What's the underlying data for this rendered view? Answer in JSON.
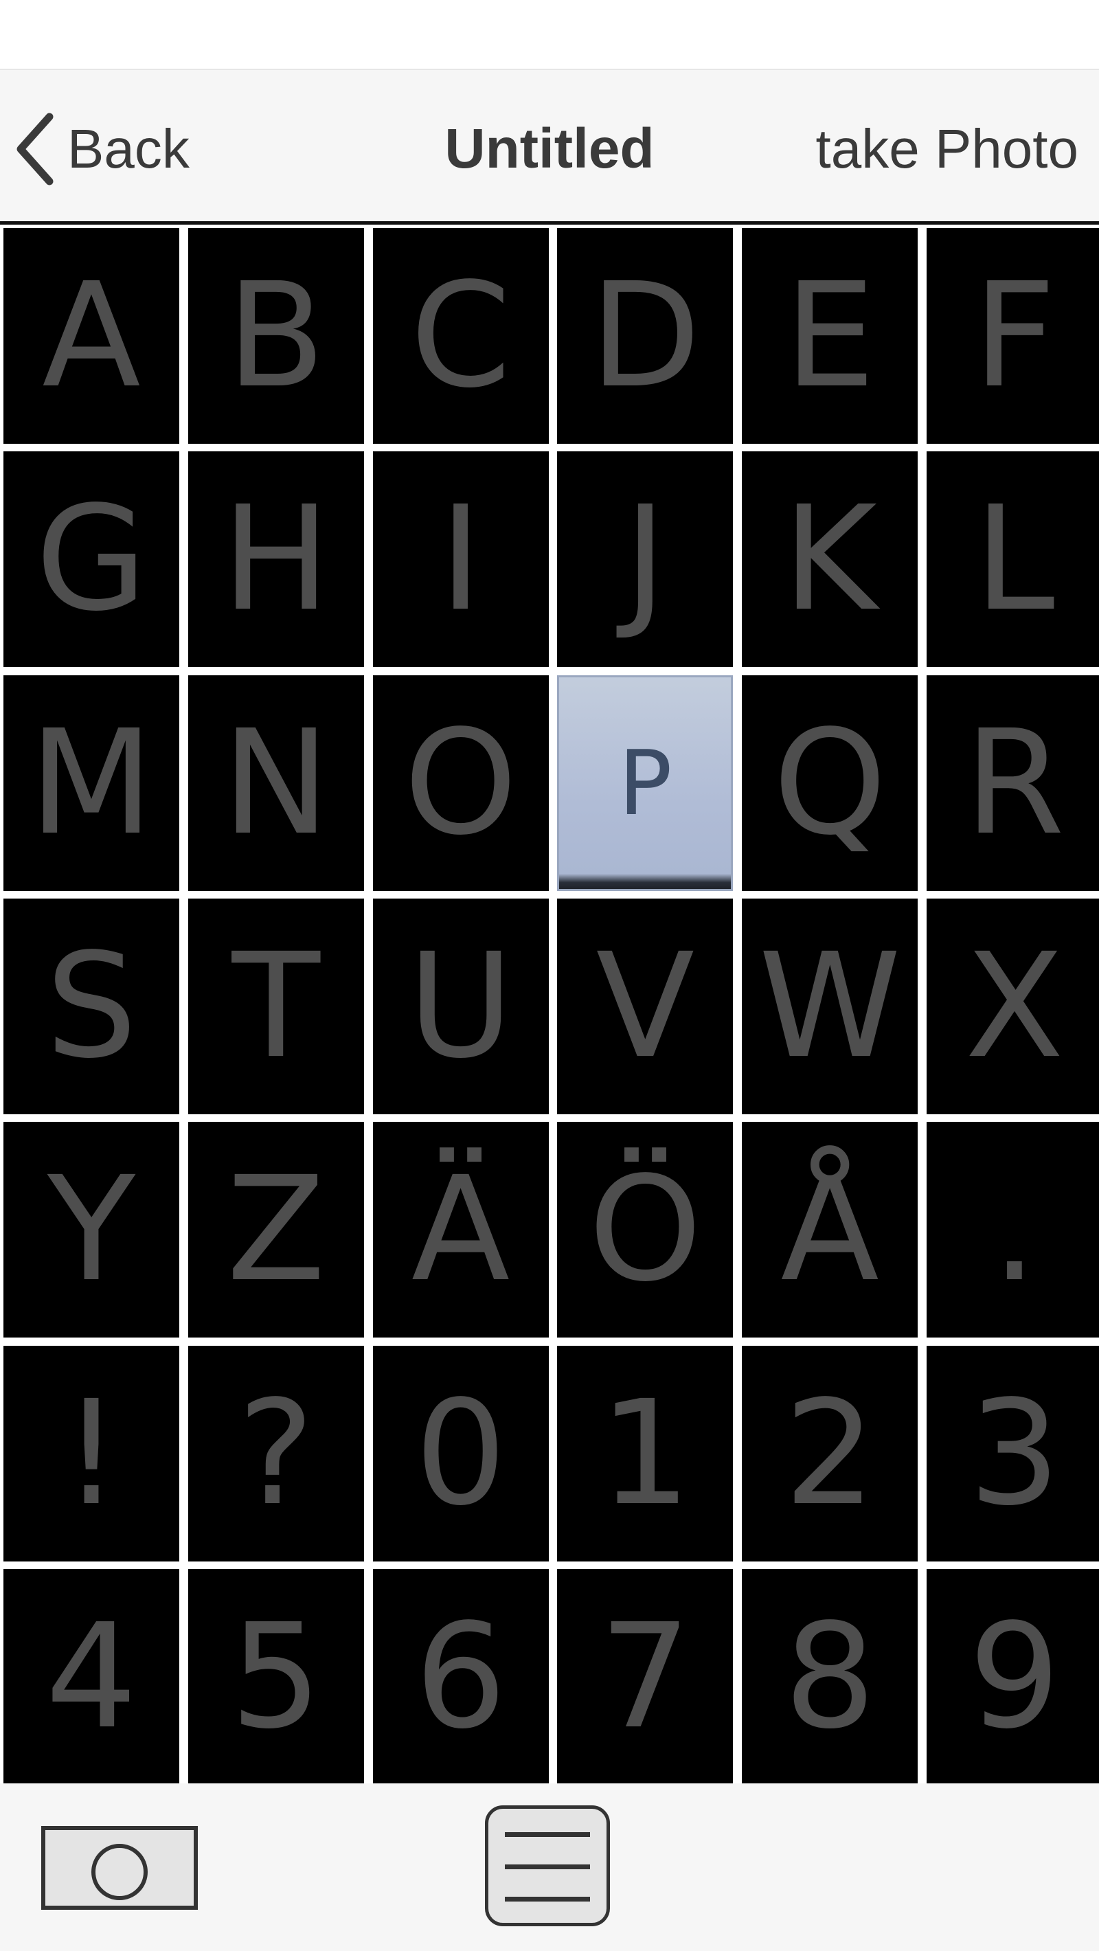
{
  "nav": {
    "back_label": "Back",
    "title": "Untitled",
    "take_photo_label": "take Photo"
  },
  "grid": {
    "selected": "P",
    "cells": [
      "A",
      "B",
      "C",
      "D",
      "E",
      "F",
      "G",
      "H",
      "I",
      "J",
      "K",
      "L",
      "M",
      "N",
      "O",
      "P",
      "Q",
      "R",
      "S",
      "T",
      "U",
      "V",
      "W",
      "X",
      "Y",
      "Z",
      "Ä",
      "Ö",
      "Å",
      ".",
      "!",
      "?",
      "0",
      "1",
      "2",
      "3",
      "4",
      "5",
      "6",
      "7",
      "8",
      "9"
    ]
  },
  "toolbar": {
    "camera_icon": "camera-icon",
    "menu_icon": "menu-icon"
  }
}
